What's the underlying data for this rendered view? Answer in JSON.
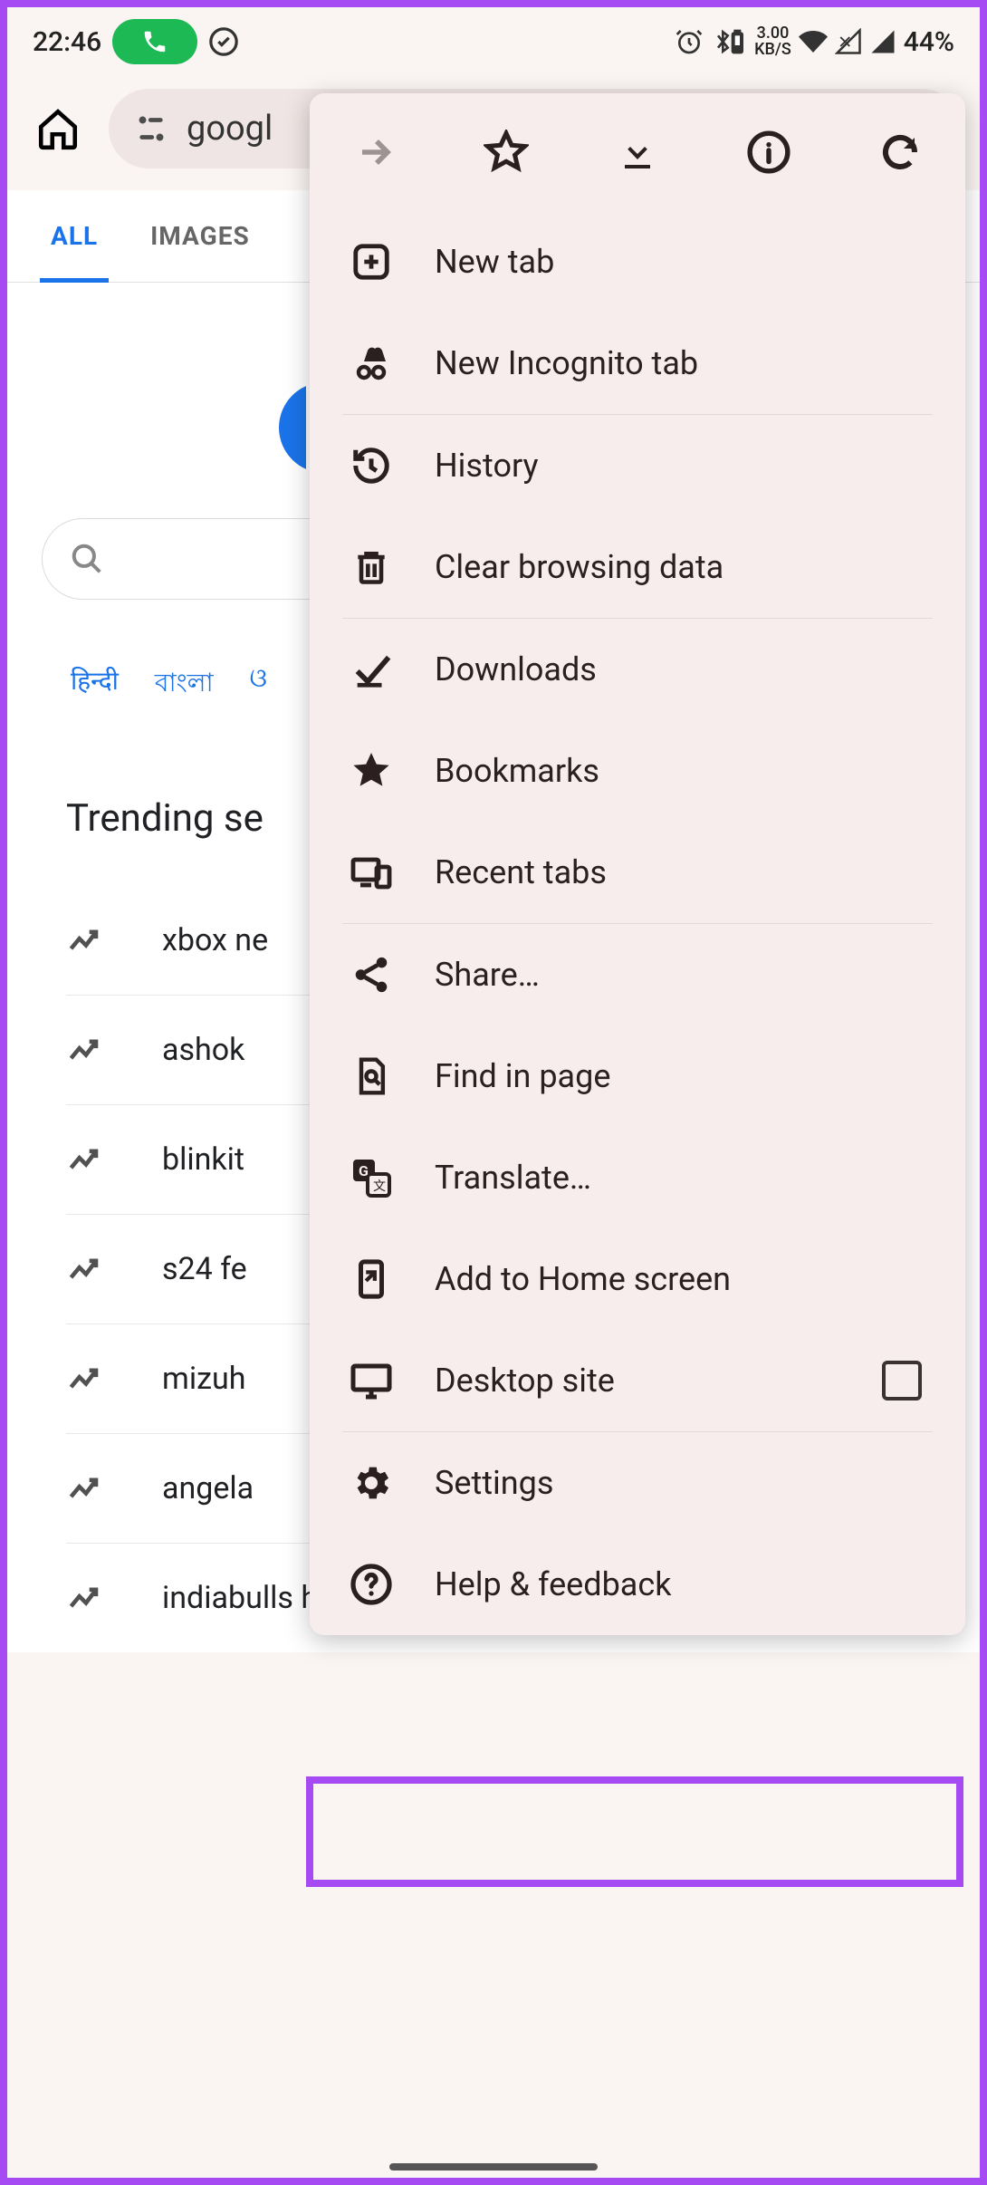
{
  "status": {
    "time": "22:46",
    "kbs_top": "3.00",
    "kbs_bot": "KB/S",
    "battery": "44%"
  },
  "omnibox": {
    "text": "googl"
  },
  "tabs": {
    "all": "ALL",
    "images": "IMAGES"
  },
  "search": {
    "placeholder": ""
  },
  "languages": {
    "hindi": "हिन्दी",
    "bangla": "বাংলা",
    "third": "ଓ"
  },
  "trending": {
    "title": "Trending se",
    "items": [
      "xbox ne",
      "ashok ",
      "blinkit ",
      "s24 fe",
      "mizuh",
      "angela",
      "indiabulls housing finance"
    ]
  },
  "menu": {
    "items": {
      "new_tab": "New tab",
      "incognito": "New Incognito tab",
      "history": "History",
      "clear": "Clear browsing data",
      "downloads": "Downloads",
      "bookmarks": "Bookmarks",
      "recent": "Recent tabs",
      "share": "Share…",
      "find": "Find in page",
      "translate": "Translate…",
      "addhome": "Add to Home screen",
      "desktop": "Desktop site",
      "settings": "Settings",
      "help": "Help & feedback"
    }
  }
}
